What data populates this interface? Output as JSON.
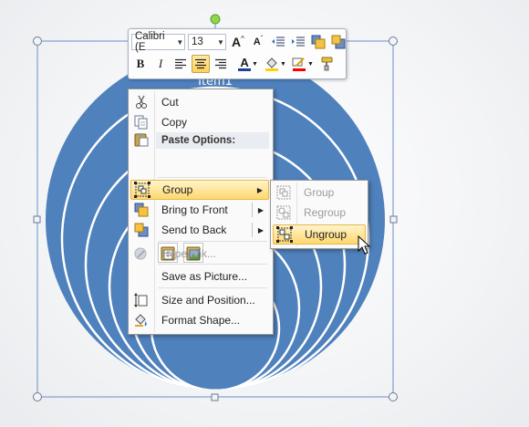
{
  "shape": {
    "label": "Item1",
    "fill_color": "#4f81bd",
    "stroke_color": "#ffffff"
  },
  "mini_toolbar": {
    "font_name": "Calibri (E",
    "font_size": "13",
    "buttons_row1": [
      "grow-font-icon",
      "shrink-font-icon",
      "decrease-indent-icon",
      "increase-indent-icon",
      "bring-forward-icon",
      "send-backward-icon"
    ],
    "buttons_row2": [
      "bold-icon",
      "italic-icon",
      "align-left-icon",
      "align-center-icon",
      "align-right-icon",
      "font-color-icon",
      "shape-fill-icon",
      "highlight-icon",
      "format-painter-icon"
    ],
    "bold_glyph": "B",
    "italic_glyph": "I",
    "font_color_glyph": "A",
    "grow_font_glyph": "A",
    "shrink_font_glyph": "A",
    "font_color": "#1f3ea0",
    "fill_accent": "#ffd200",
    "highlight_accent": "#ff0000"
  },
  "context_menu": {
    "items": [
      {
        "label": "Cut",
        "icon": "scissors-icon",
        "enabled": true
      },
      {
        "label": "Copy",
        "icon": "copy-icon",
        "enabled": true
      },
      {
        "label": "Paste Options:",
        "icon": "paste-icon",
        "enabled": true
      },
      {
        "label": "Group",
        "icon": "group-icon",
        "enabled": true
      },
      {
        "label": "Bring to Front",
        "icon": "bring-to-front-icon",
        "enabled": true
      },
      {
        "label": "Send to Back",
        "icon": "send-to-back-icon",
        "enabled": true
      },
      {
        "label": "Hyperlink...",
        "icon": "hyperlink-icon",
        "enabled": false
      },
      {
        "label": "Save as Picture...",
        "icon": "",
        "enabled": true
      },
      {
        "label": "Size and Position...",
        "icon": "size-position-icon",
        "enabled": true
      },
      {
        "label": "Format Shape...",
        "icon": "format-shape-icon",
        "enabled": true
      }
    ],
    "paste_options": [
      "paste-keep-text-icon",
      "paste-picture-icon"
    ],
    "highlight_color": "#ffd86e"
  },
  "group_submenu": {
    "items": [
      {
        "label": "Group",
        "icon": "group-icon",
        "enabled": false
      },
      {
        "label": "Regroup",
        "icon": "regroup-icon",
        "enabled": false
      },
      {
        "label": "Ungroup",
        "icon": "ungroup-icon",
        "enabled": true
      }
    ]
  }
}
